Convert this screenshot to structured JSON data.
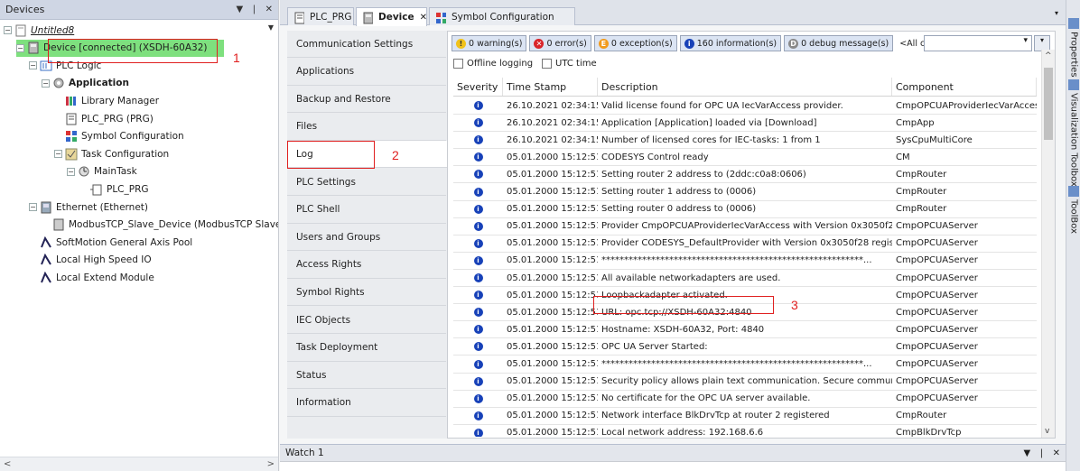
{
  "devices_panel": {
    "title": "Devices",
    "pin": "❘",
    "close": "✕",
    "tree": [
      {
        "label": "Untitled8",
        "icon": "project-icon",
        "expand": "−",
        "style": "italic"
      },
      {
        "label": "Device [connected] (XSDH-60A32)",
        "icon": "device-icon",
        "expand": "−",
        "style": "selected"
      },
      {
        "label": "PLC Logic",
        "icon": "plc-logic-icon",
        "expand": "−",
        "style": ""
      },
      {
        "label": "Application",
        "icon": "application-icon",
        "expand": "−",
        "style": "bold"
      },
      {
        "label": "Library Manager",
        "icon": "library-icon",
        "expand": "",
        "style": ""
      },
      {
        "label": "PLC_PRG (PRG)",
        "icon": "pou-icon",
        "expand": "",
        "style": ""
      },
      {
        "label": "Symbol Configuration",
        "icon": "symbol-config-icon",
        "expand": "",
        "style": ""
      },
      {
        "label": "Task Configuration",
        "icon": "task-config-icon",
        "expand": "−",
        "style": ""
      },
      {
        "label": "MainTask",
        "icon": "task-icon",
        "expand": "−",
        "style": ""
      },
      {
        "label": "PLC_PRG",
        "icon": "pou-call-icon",
        "expand": "",
        "style": ""
      },
      {
        "label": "Ethernet (Ethernet)",
        "icon": "ethernet-icon",
        "expand": "−",
        "style": ""
      },
      {
        "label": "ModbusTCP_Slave_Device (ModbusTCP Slave Devi",
        "icon": "modbus-icon",
        "expand": "",
        "style": ""
      },
      {
        "label": "SoftMotion General Axis Pool",
        "icon": "axis-pool-icon",
        "expand": "",
        "style": ""
      },
      {
        "label": "Local High Speed IO",
        "icon": "io-icon",
        "expand": "",
        "style": ""
      },
      {
        "label": "Local Extend Module",
        "icon": "module-icon",
        "expand": "",
        "style": ""
      }
    ]
  },
  "tabs": [
    {
      "label": "PLC_PRG",
      "icon": "pou-icon",
      "active": false
    },
    {
      "label": "Device",
      "icon": "device-icon",
      "active": true,
      "close": "✕"
    },
    {
      "label": "Symbol Configuration",
      "icon": "symbol-config-icon",
      "active": false
    }
  ],
  "tab_dropdown": "▾",
  "right_toolbar": [
    "Properties",
    "Visualization Toolbox",
    "ToolBox"
  ],
  "device_nav": [
    "Communication Settings",
    "Applications",
    "Backup and Restore",
    "Files",
    "Log",
    "PLC Settings",
    "PLC Shell",
    "Users and Groups",
    "Access Rights",
    "Symbol Rights",
    "IEC Objects",
    "Task Deployment",
    "Status",
    "Information"
  ],
  "device_nav_active": "Log",
  "log_filter": {
    "warnings": "0 warning(s)",
    "errors": "0 error(s)",
    "exceptions": "0 exception(s)",
    "information": "160 information(s)",
    "debug": "0 debug message(s)",
    "components": "<All components>",
    "combo_arrow": "▾"
  },
  "log_options": {
    "offline_logging": "Offline logging",
    "utc_time": "UTC time"
  },
  "log_table": {
    "columns": [
      "Severity",
      "Time Stamp",
      "Description",
      "Component"
    ],
    "rows": [
      [
        "26.10.2021 02:34:15...",
        "Valid license found for OPC UA IecVarAccess provider.",
        "CmpOPCUAProviderIecVarAccess"
      ],
      [
        "26.10.2021 02:34:15...",
        "Application [Application] loaded via [Download]",
        "CmpApp"
      ],
      [
        "26.10.2021 02:34:15...",
        "Number of licensed cores for IEC-tasks: 1 from 1",
        "SysCpuMultiCore"
      ],
      [
        "05.01.2000 15:12:51...",
        "CODESYS Control ready",
        "CM"
      ],
      [
        "05.01.2000 15:12:51...",
        "Setting router 2 address to (2ddc:c0a8:0606)",
        "CmpRouter"
      ],
      [
        "05.01.2000 15:12:51...",
        "Setting router 1 address to (0006)",
        "CmpRouter"
      ],
      [
        "05.01.2000 15:12:51...",
        "Setting router 0 address to (0006)",
        "CmpRouter"
      ],
      [
        "05.01.2000 15:12:51...",
        "Provider CmpOPCUAProviderIecVarAccess with Version 0x3050f28 regist...",
        "CmpOPCUAServer"
      ],
      [
        "05.01.2000 15:12:51...",
        "Provider CODESYS_DefaultProvider with Version 0x3050f28 registerd at t...",
        "CmpOPCUAServer"
      ],
      [
        "05.01.2000 15:12:51...",
        "**********************************************************...",
        "CmpOPCUAServer"
      ],
      [
        "05.01.2000 15:12:51...",
        "All available networkadapters are used.",
        "CmpOPCUAServer"
      ],
      [
        "05.01.2000 15:12:51...",
        "Loopbackadapter activated.",
        "CmpOPCUAServer"
      ],
      [
        "05.01.2000 15:12:51...",
        "URL: opc.tcp://XSDH-60A32:4840",
        "CmpOPCUAServer"
      ],
      [
        "05.01.2000 15:12:51...",
        "Hostname: XSDH-60A32, Port: 4840",
        "CmpOPCUAServer"
      ],
      [
        "05.01.2000 15:12:51...",
        "OPC UA Server Started:",
        "CmpOPCUAServer"
      ],
      [
        "05.01.2000 15:12:51...",
        "**********************************************************...",
        "CmpOPCUAServer"
      ],
      [
        "05.01.2000 15:12:51...",
        "Security policy allows plain text communication. Secure communication is ...",
        "CmpOPCUAServer"
      ],
      [
        "05.01.2000 15:12:51...",
        "No certificate for the OPC UA server available.",
        "CmpOPCUAServer"
      ],
      [
        "05.01.2000 15:12:51...",
        "Network interface BlkDrvTcp at router 2 registered",
        "CmpRouter"
      ],
      [
        "05.01.2000 15:12:51...",
        "Local network address: 192.168.6.6",
        "CmpBlkDrvTcp"
      ]
    ]
  },
  "watch_panel": {
    "title": "Watch 1"
  },
  "annotations": [
    "1",
    "2",
    "3"
  ],
  "colors": {
    "selected_device": "#7ee07e",
    "annotation": "#e02020",
    "info": "#1741b8"
  }
}
